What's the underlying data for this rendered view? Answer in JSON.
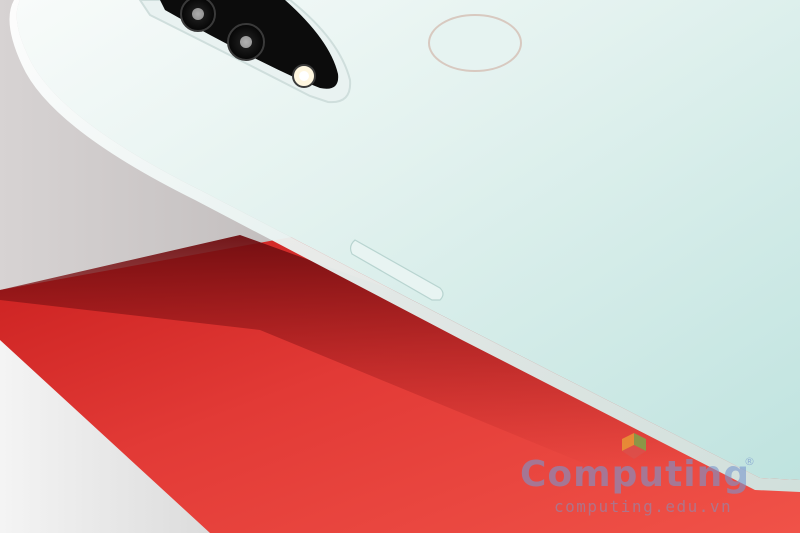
{
  "photo": {
    "subject": "smartphone-back",
    "colors": {
      "backdrop_red": "#e23a36",
      "backdrop_white": "#eeeeee",
      "phone_mint": "#cfe9e6",
      "phone_white": "#f3f7f6"
    }
  },
  "watermark": {
    "brand": "Computing",
    "registered_mark": "®",
    "url": "computing.edu.vn",
    "logo_icon": "computing-logo-icon"
  }
}
